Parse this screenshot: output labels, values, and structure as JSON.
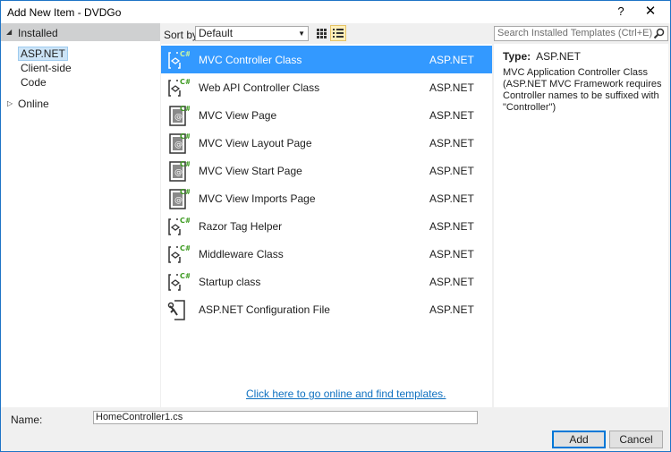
{
  "window": {
    "title": "Add New Item - DVDGo",
    "help_label": "?",
    "close_label": "✕"
  },
  "tree": {
    "installed": "Installed",
    "items": [
      "ASP.NET",
      "Client-side",
      "Code"
    ],
    "online": "Online"
  },
  "toolbar": {
    "sort_label": "Sort by:",
    "sort_value": "Default",
    "search_placeholder": "Search Installed Templates (Ctrl+E)"
  },
  "templates": [
    {
      "name": "MVC Controller Class",
      "category": "ASP.NET",
      "icon": "controller-icon"
    },
    {
      "name": "Web API Controller Class",
      "category": "ASP.NET",
      "icon": "controller-icon"
    },
    {
      "name": "MVC View Page",
      "category": "ASP.NET",
      "icon": "view-page-icon"
    },
    {
      "name": "MVC View Layout Page",
      "category": "ASP.NET",
      "icon": "view-page-icon"
    },
    {
      "name": "MVC View Start Page",
      "category": "ASP.NET",
      "icon": "view-page-icon"
    },
    {
      "name": "MVC View Imports Page",
      "category": "ASP.NET",
      "icon": "view-page-icon"
    },
    {
      "name": "Razor Tag Helper",
      "category": "ASP.NET",
      "icon": "controller-icon"
    },
    {
      "name": "Middleware Class",
      "category": "ASP.NET",
      "icon": "controller-icon"
    },
    {
      "name": "Startup class",
      "category": "ASP.NET",
      "icon": "controller-icon"
    },
    {
      "name": "ASP.NET Configuration File",
      "category": "ASP.NET",
      "icon": "config-file-icon"
    }
  ],
  "online_link": "Click here to go online and find templates.",
  "details": {
    "type_label": "Type:",
    "type_value": "ASP.NET",
    "description": "MVC Application Controller Class (ASP.NET MVC Framework requires Controller names to be suffixed with \"Controller\")"
  },
  "footer": {
    "name_label": "Name:",
    "name_value": "HomeController1.cs",
    "add_label": "Add",
    "cancel_label": "Cancel"
  },
  "colors": {
    "selection": "#3399ff",
    "link": "#0e70c0",
    "csharp_badge": "#3c9a1f"
  }
}
